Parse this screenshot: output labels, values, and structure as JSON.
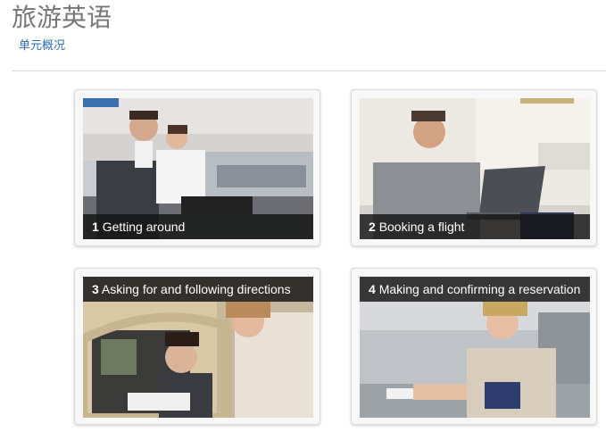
{
  "page": {
    "title": "旅游英语",
    "overview_link": "单元概况"
  },
  "units": [
    {
      "number": "1",
      "title": "Getting around"
    },
    {
      "number": "2",
      "title": "Booking a flight"
    },
    {
      "number": "3",
      "title": "Asking for and following directions"
    },
    {
      "number": "4",
      "title": "Making and confirming a reservation"
    }
  ]
}
